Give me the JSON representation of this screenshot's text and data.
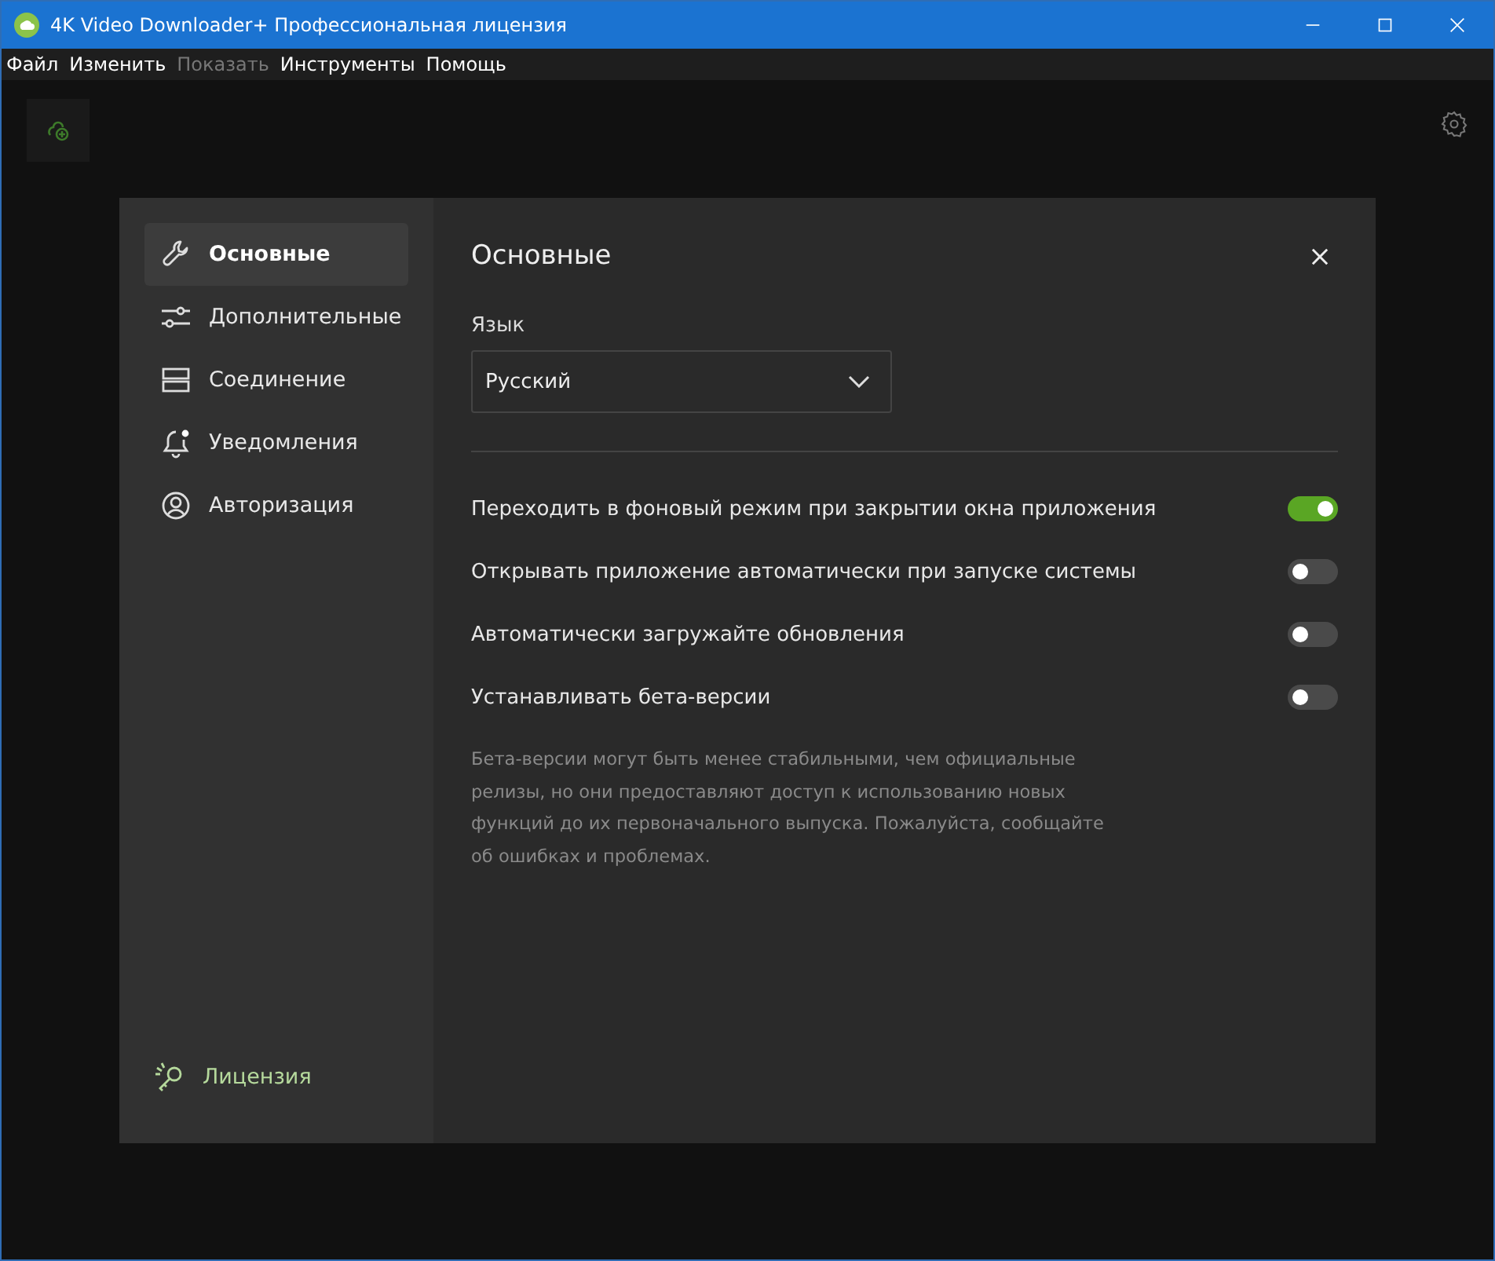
{
  "window": {
    "title": "4K Video Downloader+ Профессиональная лицензия"
  },
  "menu": [
    {
      "label": "Файл",
      "disabled": false
    },
    {
      "label": "Изменить",
      "disabled": false
    },
    {
      "label": "Показать",
      "disabled": true
    },
    {
      "label": "Инструменты",
      "disabled": false
    },
    {
      "label": "Помощь",
      "disabled": false
    }
  ],
  "sidebar": {
    "items": [
      {
        "label": "Основные",
        "kind": "wrench",
        "selected": true
      },
      {
        "label": "Дополнительные",
        "kind": "sliders",
        "selected": false
      },
      {
        "label": "Соединение",
        "kind": "server",
        "selected": false
      },
      {
        "label": "Уведомления",
        "kind": "bell",
        "selected": false
      },
      {
        "label": "Авторизация",
        "kind": "user",
        "selected": false
      }
    ],
    "license": "Лицензия"
  },
  "panel": {
    "title": "Основные",
    "language_label": "Язык",
    "language_value": "Русский",
    "toggles": [
      {
        "label": "Переходить в фоновый режим при закрытии окна приложения",
        "on": true
      },
      {
        "label": "Открывать приложение автоматически при запуске системы",
        "on": false
      },
      {
        "label": "Автоматически загружайте обновления",
        "on": false
      },
      {
        "label": "Устанавливать бета-версии",
        "on": false
      }
    ],
    "note": "Бета-версии могут быть менее стабильными, чем официальные релизы, но они предоставляют доступ к использованию новых функций до их первоначального выпуска. Пожалуйста, сообщайте об ошибках и проблемах."
  }
}
